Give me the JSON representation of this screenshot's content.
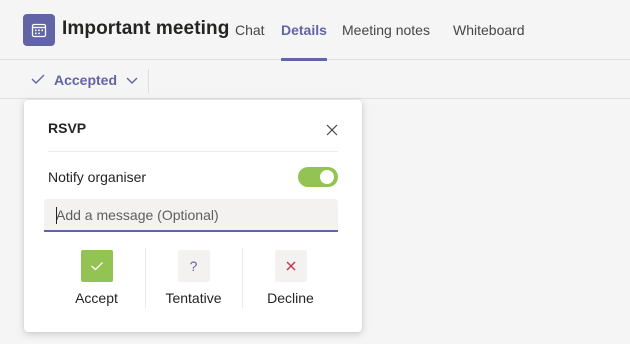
{
  "header": {
    "app_icon": "calendar-icon",
    "title": "Important meeting",
    "tabs": [
      {
        "label": "Chat",
        "active": false
      },
      {
        "label": "Details",
        "active": true
      },
      {
        "label": "Meeting notes",
        "active": false
      },
      {
        "label": "Whiteboard",
        "active": false
      }
    ]
  },
  "toolbar": {
    "rsvp_status": "Accepted",
    "status_icon": "checkmark-icon",
    "dropdown_icon": "chevron-down-icon"
  },
  "rsvp": {
    "title": "RSVP",
    "close_icon": "close-icon",
    "notify_label": "Notify organiser",
    "notify_enabled": true,
    "message_placeholder": "Add a message (Optional)",
    "message_value": "",
    "responses": [
      {
        "label": "Accept",
        "icon": "checkmark-icon",
        "color": "#92c353",
        "selected": true
      },
      {
        "label": "Tentative",
        "icon": "question-icon",
        "color": "#6264a7",
        "selected": false
      },
      {
        "label": "Decline",
        "icon": "close-icon",
        "color": "#c4314b",
        "selected": false
      }
    ]
  },
  "colors": {
    "brand": "#6264a7",
    "toggle_on": "#92c353",
    "accept": "#92c353",
    "decline": "#c4314b"
  }
}
